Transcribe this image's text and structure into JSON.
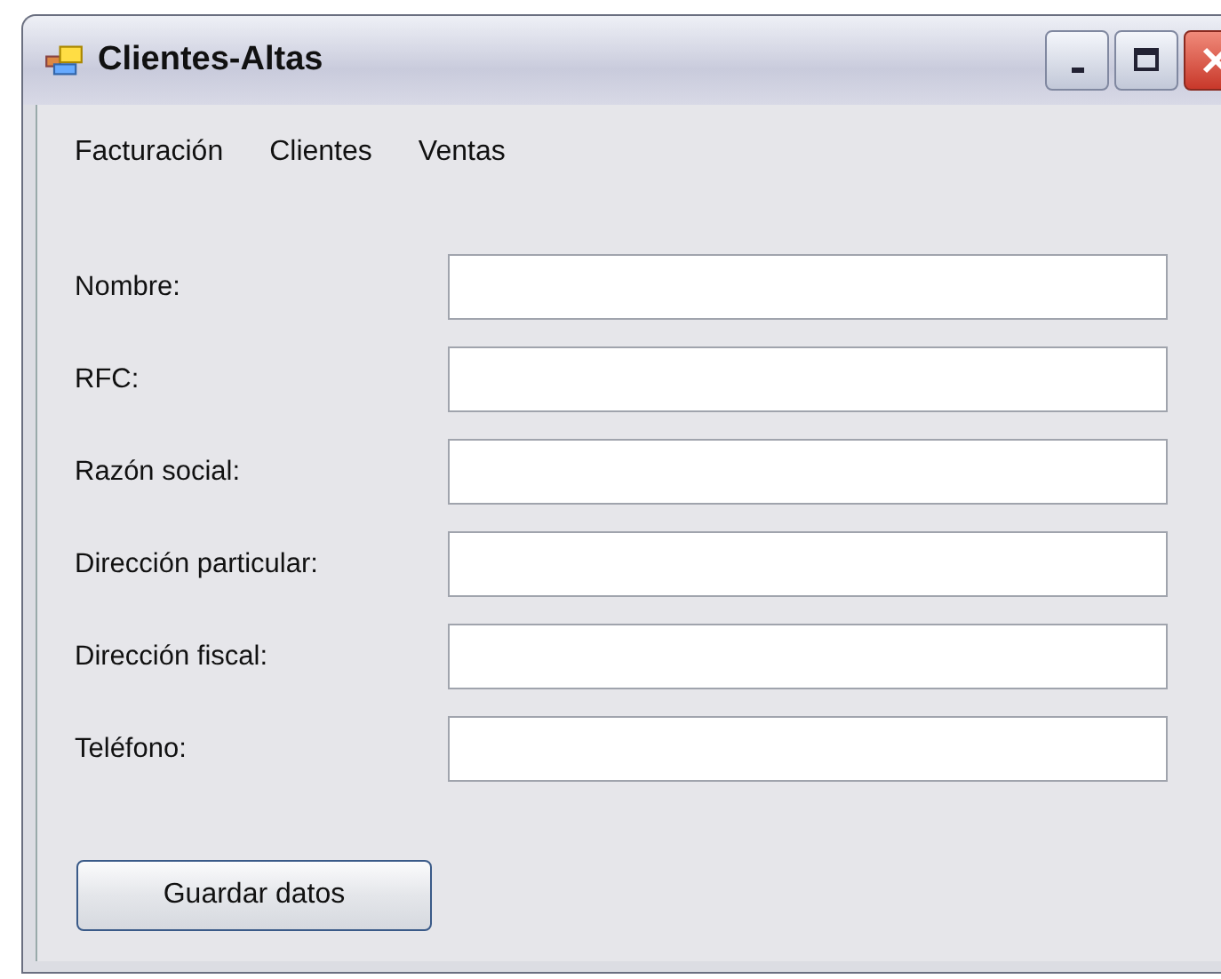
{
  "window": {
    "title": "Clientes-Altas"
  },
  "menu": [
    {
      "label": "Facturación"
    },
    {
      "label": "Clientes"
    },
    {
      "label": "Ventas"
    }
  ],
  "fields": [
    {
      "label": "Nombre:"
    },
    {
      "label": "RFC:"
    },
    {
      "label": "Razón social:"
    },
    {
      "label": "Dirección particular:"
    },
    {
      "label": "Dirección fiscal:"
    },
    {
      "label": "Teléfono:"
    }
  ],
  "buttons": [
    {
      "label": "Guardar datos"
    }
  ]
}
